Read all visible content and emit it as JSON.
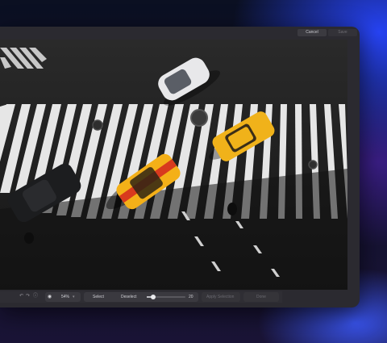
{
  "header": {
    "cancel_label": "Cancel",
    "save_label": "Save"
  },
  "toolbar": {
    "zoom_value": "54%",
    "select_label": "Select",
    "deselect_label": "Deselect",
    "brush_size": "20",
    "apply_label": "Apply Selection",
    "done_label": "Done",
    "icons": [
      "undo-icon",
      "redo-icon",
      "info-icon",
      "eye-icon",
      "chevron-down-icon"
    ]
  },
  "colors": {
    "window_bg": "#2b2a30",
    "toolbar_bg": "#2f2e34",
    "taxi_yellow": "#f0b21a",
    "accent_blue": "#3a55ff"
  }
}
